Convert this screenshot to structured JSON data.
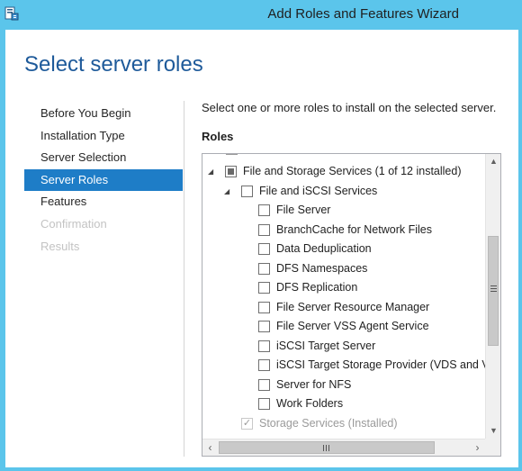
{
  "window": {
    "title": "Add Roles and Features Wizard",
    "icon": "server-wizard-icon",
    "frame_color": "#5bc5eb"
  },
  "page": {
    "title": "Select server roles",
    "title_color": "#1e5a9a"
  },
  "nav": {
    "items": [
      {
        "label": "Before You Begin",
        "state": "normal"
      },
      {
        "label": "Installation Type",
        "state": "normal"
      },
      {
        "label": "Server Selection",
        "state": "normal"
      },
      {
        "label": "Server Roles",
        "state": "active"
      },
      {
        "label": "Features",
        "state": "normal"
      },
      {
        "label": "Confirmation",
        "state": "disabled"
      },
      {
        "label": "Results",
        "state": "disabled"
      }
    ],
    "active_color": "#1e7dc7"
  },
  "content": {
    "instruction": "Select one or more roles to install on the selected server.",
    "roles_heading": "Roles"
  },
  "roles": {
    "rows": [
      {
        "label": "File and Storage Services (1 of 12 installed)",
        "level": 0,
        "expander": "expanded",
        "check": "partial"
      },
      {
        "label": "File and iSCSI Services",
        "level": 1,
        "expander": "expanded",
        "check": "unchecked"
      },
      {
        "label": "File Server",
        "level": 2,
        "expander": "none",
        "check": "unchecked"
      },
      {
        "label": "BranchCache for Network Files",
        "level": 2,
        "expander": "none",
        "check": "unchecked"
      },
      {
        "label": "Data Deduplication",
        "level": 2,
        "expander": "none",
        "check": "unchecked"
      },
      {
        "label": "DFS Namespaces",
        "level": 2,
        "expander": "none",
        "check": "unchecked"
      },
      {
        "label": "DFS Replication",
        "level": 2,
        "expander": "none",
        "check": "unchecked"
      },
      {
        "label": "File Server Resource Manager",
        "level": 2,
        "expander": "none",
        "check": "unchecked"
      },
      {
        "label": "File Server VSS Agent Service",
        "level": 2,
        "expander": "none",
        "check": "unchecked"
      },
      {
        "label": "iSCSI Target Server",
        "level": 2,
        "expander": "none",
        "check": "unchecked"
      },
      {
        "label": "iSCSI Target Storage Provider (VDS and VSS",
        "level": 2,
        "expander": "none",
        "check": "unchecked"
      },
      {
        "label": "Server for NFS",
        "level": 2,
        "expander": "none",
        "check": "unchecked"
      },
      {
        "label": "Work Folders",
        "level": 2,
        "expander": "none",
        "check": "unchecked"
      },
      {
        "label": "Storage Services (Installed)",
        "level": 1,
        "expander": "none",
        "check": "checked-disabled"
      }
    ],
    "vertical_scroll_fraction": 0.35,
    "horizontal_scroll_fraction": 0.0
  }
}
